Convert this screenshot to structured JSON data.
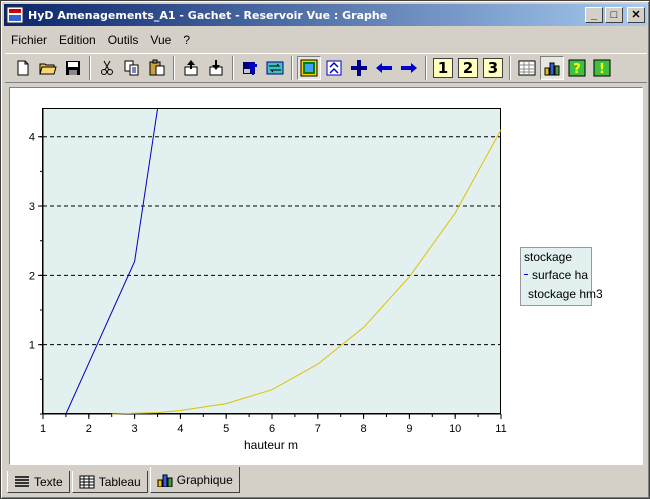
{
  "window": {
    "title": "HyD Amenagements_A1 - Gachet - Reservoir Vue  : Graphe",
    "minimize": "_",
    "maximize": "□",
    "close": "✕"
  },
  "menu": [
    "Fichier",
    "Edition",
    "Outils",
    "Vue",
    "?"
  ],
  "toolbar": {
    "icons": [
      "new-file-icon",
      "open-folder-icon",
      "save-icon",
      "cut-icon",
      "copy-icon",
      "paste-icon",
      "export-up-icon",
      "import-down-icon",
      "print-icon",
      "transfer-icon",
      "zoom-area-icon",
      "zoom-fit-icon",
      "add-cross-icon",
      "arrow-left-icon",
      "arrow-right-icon"
    ],
    "numbers": [
      "1",
      "2",
      "3"
    ],
    "view_icons": [
      "table-view-icon",
      "chart-view-icon",
      "help-icon",
      "info-icon"
    ]
  },
  "chart_data": {
    "type": "line",
    "xlabel": "hauteur m",
    "ylabel": "",
    "xlim": [
      1,
      11
    ],
    "ylim": [
      0,
      4.4
    ],
    "xticks": [
      1,
      2,
      3,
      4,
      5,
      6,
      7,
      8,
      9,
      10,
      11
    ],
    "yticks": [
      1,
      2,
      3,
      4
    ],
    "grid": "horizontal dashed",
    "legend_title": "stockage",
    "legend_position": "right",
    "series": [
      {
        "name": "surface ha",
        "color": "#0000c0",
        "x": [
          1.5,
          3.0,
          3.5
        ],
        "y": [
          0.0,
          2.2,
          4.4
        ]
      },
      {
        "name": "stockage hm3",
        "color": "#e0c000",
        "x": [
          2.5,
          3.0,
          3.5,
          4.0,
          5.0,
          6.0,
          7.0,
          8.0,
          9.0,
          10.0,
          11.0
        ],
        "y": [
          0.0,
          0.01,
          0.02,
          0.05,
          0.15,
          0.35,
          0.72,
          1.25,
          1.98,
          2.9,
          4.1
        ]
      }
    ]
  },
  "tabs": [
    {
      "label": "Texte",
      "icon": "text-lines-icon",
      "active": false
    },
    {
      "label": "Tableau",
      "icon": "table-icon",
      "active": false
    },
    {
      "label": "Graphique",
      "icon": "chart-icon",
      "active": true
    }
  ]
}
